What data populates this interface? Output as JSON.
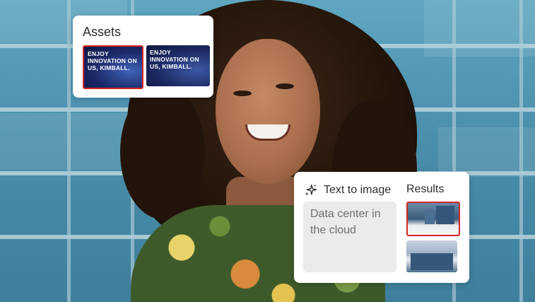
{
  "assets_panel": {
    "title": "Assets",
    "thumbnails": [
      {
        "text": "ENJOY INNOVATION ON US, KIMBALL.",
        "selected": true
      },
      {
        "text": "ENJOY INNOVATION ON US, KIMBALL.",
        "selected": false
      }
    ]
  },
  "text_to_image_panel": {
    "title": "Text to image",
    "prompt": "Data center in the cloud",
    "results_title": "Results",
    "results": [
      {
        "selected": true
      },
      {
        "selected": false
      }
    ]
  },
  "colors": {
    "accent_selection": "#d7261e",
    "prompt_bg": "#ebebeb"
  },
  "icons": {
    "text_to_image": "sparkle-icon"
  }
}
